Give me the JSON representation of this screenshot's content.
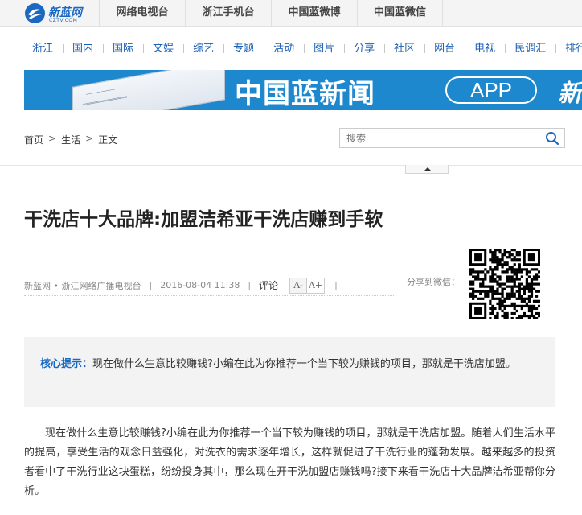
{
  "topbar": {
    "logo_text": "新蓝网",
    "logo_sub": "CZTV.COM",
    "links": [
      "网络电视台",
      "浙江手机台",
      "中国蓝微博",
      "中国蓝微信"
    ]
  },
  "nav": [
    "浙江",
    "国内",
    "国际",
    "文娱",
    "综艺",
    "专题",
    "活动",
    "图片",
    "分享",
    "社区",
    "网台",
    "电视",
    "民调汇",
    "排行榜"
  ],
  "banner": {
    "headline": "中国蓝新闻",
    "app_label": "APP",
    "tail": "新视"
  },
  "breadcrumb": {
    "items": [
      "首页",
      "生活",
      "正文"
    ],
    "separator": ">"
  },
  "search": {
    "placeholder": "搜索"
  },
  "article": {
    "title": "干洗店十大品牌:加盟洁希亚干洗店赚到手软",
    "source": "新蓝网 • 浙江网络广播电视台",
    "divider": "|",
    "datetime": "2016-08-04 11:38",
    "comment_label": "评论",
    "font_smaller": "A-",
    "font_larger": "A+",
    "share_label": "分享到微信：",
    "summary_key": "核心提示：",
    "summary_text": "现在做什么生意比较赚钱?小编在此为你推荐一个当下较为赚钱的项目，那就是干洗店加盟。",
    "paragraph": "现在做什么生意比较赚钱?小编在此为你推荐一个当下较为赚钱的项目，那就是干洗店加盟。随着人们生活水平的提高，享受生活的观念日益强化，对洗衣的需求逐年增长，这样就促进了干洗行业的蓬勃发展。越来越多的投资者看中了干洗行业这块蛋糕，纷纷投身其中，那么现在开干洗加盟店赚钱吗?接下来看干洗店十大品牌洁希亚帮你分析。"
  },
  "colors": {
    "brand_blue": "#1a68c2",
    "nav_blue": "#1a5fb4",
    "banner_blue": "#1e88cf"
  }
}
